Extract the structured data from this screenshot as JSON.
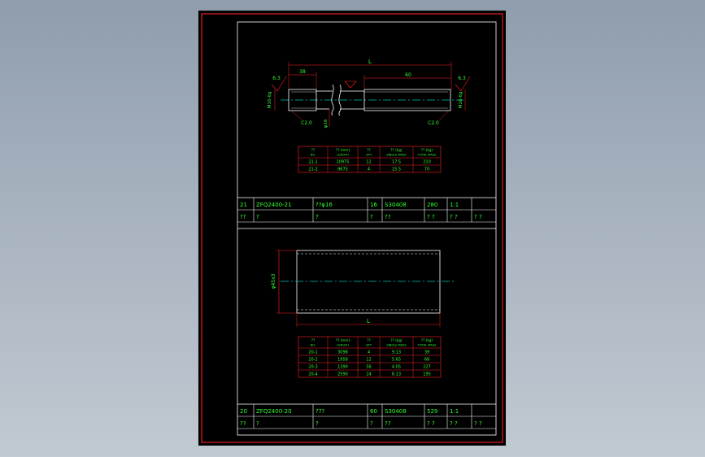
{
  "colors": {
    "background": "#9aa6b3",
    "sheet": "#000000",
    "outer_frame": "#e0201d",
    "inner_frame": "#ffffff",
    "geometry": "#ffffff",
    "dimension": "#ff2020",
    "text": "#33ff33",
    "centerline": "#00c0c0"
  },
  "part_top": {
    "dims": {
      "overall_L": "L",
      "thread_left": "38",
      "thread_right": "60",
      "roughness_left": "6.3",
      "roughness_right": "6.3",
      "thread_left_side": "M16-6g",
      "thread_right_side": "M16-6g",
      "chamfer_left": "C2.0",
      "chamfer_right": "C2.0",
      "diameter": "φ16"
    },
    "table": {
      "headers": [
        {
          "top": "??",
          "bottom": "NO."
        },
        {
          "top": "??  (mm)",
          "bottom": "LENGTH"
        },
        {
          "top": "??",
          "bottom": "QTY"
        },
        {
          "top": "??  (kg)",
          "bottom": "SINGLE MASS"
        },
        {
          "top": "??  (kg)",
          "bottom": "TOTAL MASS"
        }
      ],
      "rows": [
        [
          "21-1",
          "10975",
          "12",
          "17.5",
          "210"
        ],
        [
          "21-2",
          "9675",
          "4",
          "15.5",
          "70"
        ]
      ]
    },
    "title_block": {
      "row1": [
        "21",
        "ZFQ2400-21",
        "??φ16",
        "16",
        "S30408",
        "280",
        "1:1",
        ""
      ],
      "row2": [
        "??",
        "?",
        "?",
        "?",
        "??",
        "? ?",
        "? ?",
        "? ?"
      ]
    }
  },
  "part_bottom": {
    "dims": {
      "diameter": "φ45x3",
      "length": "L"
    },
    "table": {
      "headers": [
        {
          "top": "??",
          "bottom": "NO."
        },
        {
          "top": "??  (mm)",
          "bottom": "LENGTH"
        },
        {
          "top": "??",
          "bottom": "QTY"
        },
        {
          "top": "??  (kg)",
          "bottom": "SINGLE MASS"
        },
        {
          "top": "??  (kg)",
          "bottom": "TOTAL MASS"
        }
      ],
      "rows": [
        [
          "20-1",
          "3098",
          "4",
          "9.13",
          "39"
        ],
        [
          "20-2",
          "1958",
          "12",
          "5.65",
          "68"
        ],
        [
          "20-3",
          "1390",
          "56",
          "4.05",
          "227"
        ],
        [
          "20-4",
          "2590",
          "24",
          "8.13",
          "195"
        ]
      ]
    },
    "title_block": {
      "row1": [
        "20",
        "ZFQ2400-20",
        "???",
        "60",
        "S30408",
        "529",
        "1:1",
        ""
      ],
      "row2": [
        "??",
        "?",
        "?",
        "?",
        "??",
        "? ?",
        "? ?",
        "? ?"
      ]
    }
  }
}
